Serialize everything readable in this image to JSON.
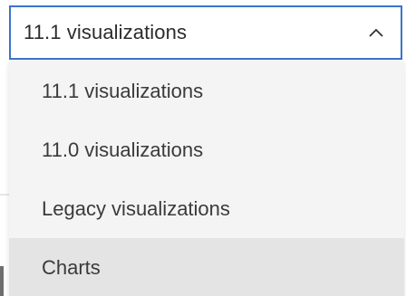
{
  "select": {
    "value": "11.1 visualizations",
    "expanded": true,
    "icon": "chevron-up-icon"
  },
  "menu": {
    "items": [
      {
        "label": "11.1 visualizations"
      },
      {
        "label": "11.0 visualizations"
      },
      {
        "label": "Legacy visualizations"
      },
      {
        "label": "Charts"
      }
    ],
    "hovered_index": 3
  },
  "colors": {
    "focus_border": "#3b74c9",
    "menu_background": "#f4f4f4",
    "hover_background": "#e4e4e4",
    "text": "#3a3a3a"
  }
}
